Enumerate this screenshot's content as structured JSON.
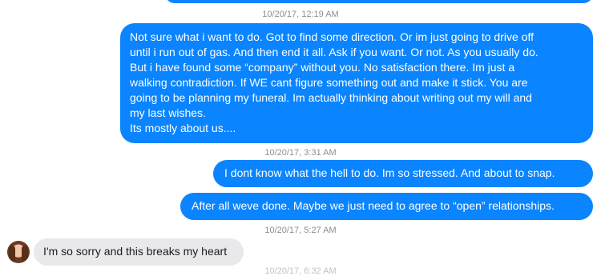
{
  "messages": {
    "ts1": "10/20/17, 12:19 AM",
    "m1_lines": [
      "Not sure what i want to do. Got to find some direction. Or im just going to drive off",
      "until i run out of gas. And then end it all.   Ask if you want. Or not. As you usually do.",
      "But i have found some “company” without you. No satisfaction there. Im just a",
      "walking contradiction. If WE cant figure something out and make it stick. You are",
      "going to be planning my funeral. Im actually thinking about writing out my will and",
      "my last wishes.",
      "Its mostly about us...."
    ],
    "ts2": "10/20/17, 3:31 AM",
    "m2": "I dont know what the hell to do. Im so stressed. And about to snap.",
    "m3": "After all weve done. Maybe we just need to agree to “open” relationships.",
    "ts3": "10/20/17, 5:27 AM",
    "m4": "I'm so sorry and this breaks my heart",
    "ts4_partial": "10/20/17, 6:32 AM"
  },
  "colors": {
    "sent_bubble": "#0a84ff",
    "received_bubble": "#e9e9eb",
    "timestamp": "#8e8e93"
  }
}
